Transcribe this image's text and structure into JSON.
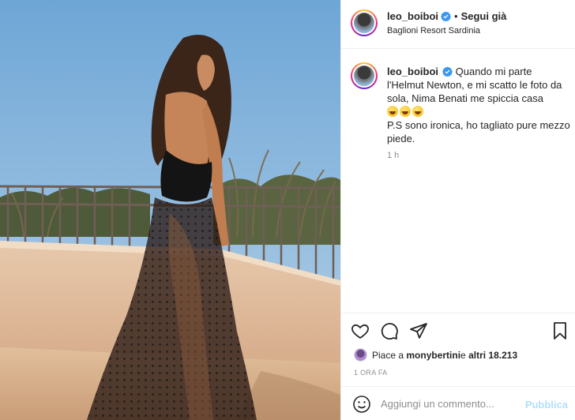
{
  "post": {
    "username": "leo_boiboi",
    "follow_separator": "•",
    "follow_label": "Segui già",
    "location": "Baglioni Resort Sardinia"
  },
  "caption": {
    "username": "leo_boiboi",
    "text_line_1": "Quando mi parte l'Helmut Newton, e mi scatto le foto da sola, Nima Benati me spiccia casa",
    "text_line_2": "P.S sono ironica, ho tagliato pure mezzo piede.",
    "emoji_count": 3,
    "time": "1 h"
  },
  "actions": {
    "icons": [
      "heart-icon",
      "comment-icon",
      "share-icon",
      "bookmark-icon"
    ]
  },
  "likes": {
    "prefix": "Piace a ",
    "user": "monybertini",
    "middle": " e ",
    "others": "altri 18.213"
  },
  "date": "1 ORA FA",
  "add_comment": {
    "placeholder": "Aggiungi un commento...",
    "publish_label": "Pubblica"
  },
  "colors": {
    "verified": "#3897f0",
    "publish_disabled": "#b2dffc",
    "secondary_text": "#8e8e8e",
    "sky": "#7fb0d9"
  }
}
